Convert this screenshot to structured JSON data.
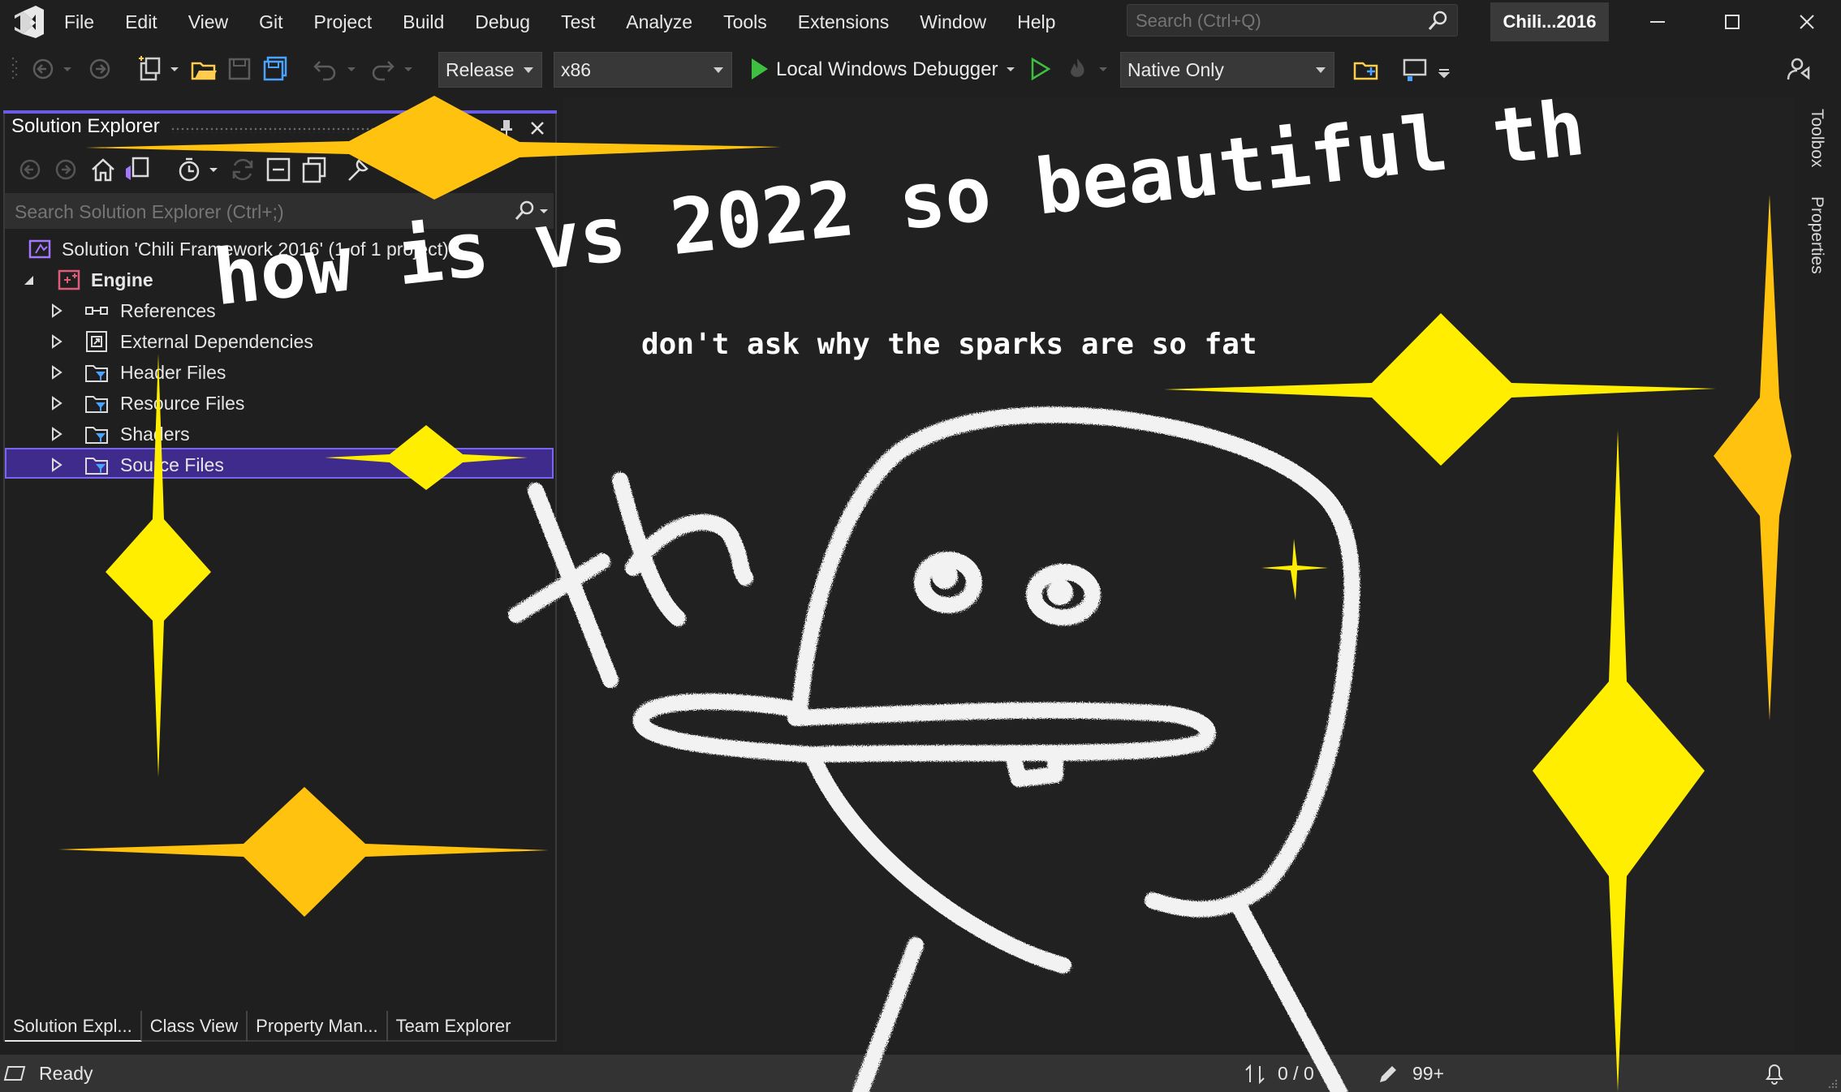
{
  "menu": [
    "File",
    "Edit",
    "View",
    "Git",
    "Project",
    "Build",
    "Debug",
    "Test",
    "Analyze",
    "Tools",
    "Extensions",
    "Window",
    "Help"
  ],
  "search": {
    "placeholder": "Search (Ctrl+Q)"
  },
  "solution_badge": "Chili...2016",
  "toolbar": {
    "config": "Release",
    "platform": "x86",
    "debugger": "Local Windows Debugger",
    "debug_mode": "Native Only"
  },
  "solution_explorer": {
    "title": "Solution Explorer",
    "search_placeholder": "Search Solution Explorer (Ctrl+;)",
    "solution": "Solution 'Chili Framework 2016' (1 of 1 project)",
    "project": "Engine",
    "items": [
      "References",
      "External Dependencies",
      "Header Files",
      "Resource Files",
      "Shaders",
      "Source Files"
    ],
    "tabs": [
      "Solution Expl...",
      "Class View",
      "Property Man...",
      "Team Explorer"
    ]
  },
  "right_rail": [
    "Toolbox",
    "Properties"
  ],
  "status": {
    "text": "Ready",
    "lines": "0 / 0",
    "errors": "99+"
  },
  "meme": {
    "title": "how is vs 2022 so beautiful th",
    "subtitle": "don't ask why the sparks are so fat",
    "scribble": "th"
  },
  "colors": {
    "accent": "#6b5ce7",
    "selection": "#3f2b8c",
    "spark_yellow": "#ffee00",
    "spark_orange": "#ffc20e",
    "run_green": "#3fbf3f"
  }
}
